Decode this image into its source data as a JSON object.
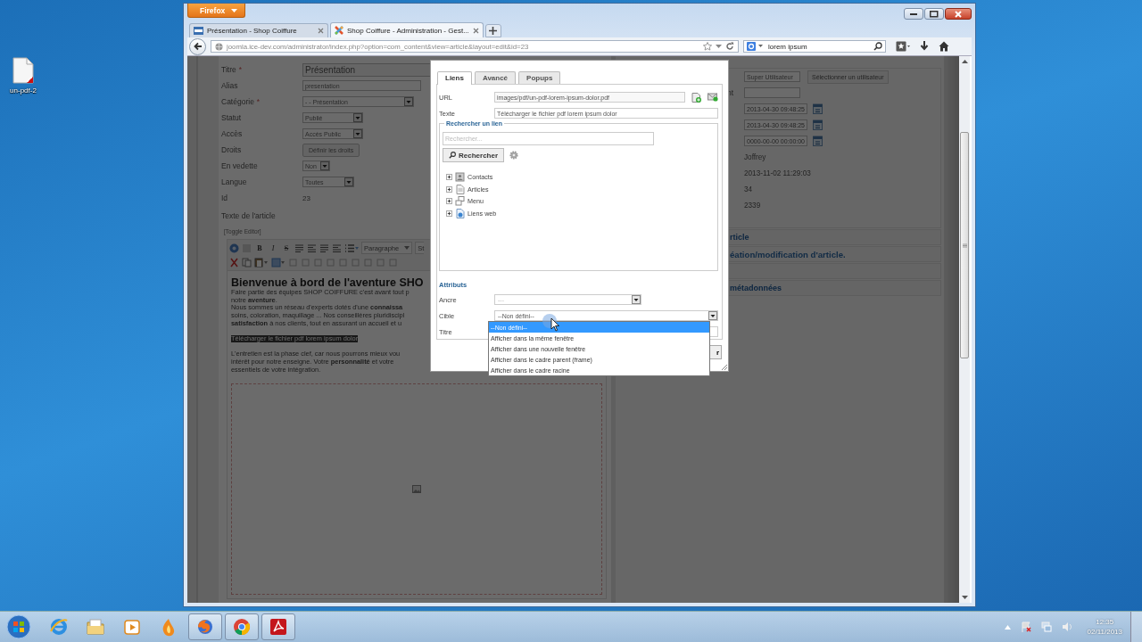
{
  "desktop_icons": [
    {
      "label": "un-pdf-2"
    }
  ],
  "browser": {
    "menu_button": "Firefox",
    "tabs": [
      {
        "kind": "site",
        "title": "Présentation - Shop Coiffure",
        "selected": false
      },
      {
        "kind": "admin",
        "title": "Shop Coiffure - Administration - Gest...",
        "selected": true
      }
    ],
    "address": "joomla.ice-dev.com/administrator/index.php?option=com_content&view=article&layout=edit&id=23",
    "search_value": "lorem ipsum"
  },
  "article_form": {
    "fields": [
      {
        "label": "Titre",
        "marker": "*",
        "kind": "title",
        "value": "Présentation"
      },
      {
        "label": "Alias",
        "kind": "text",
        "value": "presentation"
      },
      {
        "label": "Catégorie",
        "marker": "*",
        "kind": "select",
        "value": "- - Présentation"
      },
      {
        "label": "Statut",
        "kind": "select",
        "value": "Publié"
      },
      {
        "label": "Accès",
        "kind": "select",
        "value": "Accès Public"
      },
      {
        "label": "Droits",
        "kind": "button",
        "value": "Définir les droits"
      },
      {
        "label": "En vedette",
        "kind": "select",
        "value": "Non"
      },
      {
        "label": "Langue",
        "kind": "select",
        "value": "Toutes"
      },
      {
        "label": "Id",
        "kind": "static",
        "value": "23"
      }
    ],
    "text_label": "Texte de l'article",
    "toggle_editor": "[Toggle Editor]",
    "format_buttons": [
      "B",
      "I",
      "S"
    ],
    "format_select": "Paragraphe",
    "styles_select": "St"
  },
  "editor": {
    "heading": "Bienvenue à bord de l'aventure SHO",
    "blocks": [
      {
        "kind": "paragraph",
        "lines": [
          "Faire partie des équipes SHOP COIFFURE c'est avant tout p",
          "notre **aventure**.",
          "Nous sommes un réseau d'experts dotés d'une **connaissa**",
          "soins, coloration, maquillage ... Nos conseillères pluridiscipl",
          "**satisfaction** à nos clients, tout en assurant un accueil et u"
        ]
      },
      {
        "kind": "link",
        "lines": [
          "Télécharger le fichier pdf lorem ipsum dolor"
        ]
      },
      {
        "kind": "paragraph",
        "lines": [
          "L'entretien est la phase clef, car nous pourrons mieux vou",
          "intérêt pour notre enseigne. Votre **personnalité** et votre",
          "essentiels de votre intégration."
        ]
      }
    ]
  },
  "publishing_panel": {
    "rows": [
      {
        "kind": "user",
        "value": "Super Utilisateur",
        "button": "Sélectionner un utilisateur"
      },
      {
        "kind": "field",
        "label": "nt"
      },
      {
        "kind": "date",
        "value": "2013-04-30 09:48:25"
      },
      {
        "kind": "date",
        "value": "2013-04-30 09:48:25"
      },
      {
        "kind": "date",
        "value": "0000-00-00 00:00:00"
      },
      {
        "kind": "static",
        "value": "Joffrey"
      },
      {
        "kind": "static",
        "value": "2013-11-02 11:29:03"
      },
      {
        "kind": "static",
        "value": "34"
      },
      {
        "kind": "static",
        "value": "2339"
      }
    ],
    "sections": [
      {
        "kind": "heading",
        "title": "rticle"
      },
      {
        "kind": "note",
        "title": "éation/modification d'article."
      },
      {
        "kind": "blank"
      },
      {
        "kind": "heading",
        "title": "métadonnées"
      }
    ]
  },
  "link_dialog": {
    "tabs": [
      {
        "label": "Liens",
        "selected": true
      },
      {
        "label": "Avancé",
        "selected": false
      },
      {
        "label": "Popups",
        "selected": false
      }
    ],
    "url_label": "URL",
    "url": "images/pdf/un-pdf-lorem-ipsum-dolor.pdf",
    "text_label": "Texte",
    "text": "Télécharger le fichier pdf lorem ipsum dolor",
    "search_legend": "Rechercher un lien",
    "search_placeholder": "Rechercher...",
    "search_button": "Rechercher",
    "tree": [
      {
        "kind": "contacts",
        "label": "Contacts",
        "expanded": false
      },
      {
        "kind": "articles",
        "label": "Articles",
        "expanded": false
      },
      {
        "kind": "menu",
        "label": "Menu",
        "expanded": false
      },
      {
        "kind": "weblinks",
        "label": "Liens web",
        "expanded": false
      }
    ],
    "attributes_heading": "Attributs",
    "anchor_label": "Ancre",
    "anchor_value": "---",
    "target_label": "Cible",
    "target_value": "--Non défini--",
    "title_label": "Titre",
    "target_options": [
      {
        "label": "--Non défini--",
        "selected": true
      },
      {
        "label": "Afficher dans la même fenêtre",
        "selected": false
      },
      {
        "label": "Afficher dans une nouvelle fenêtre",
        "selected": false
      },
      {
        "label": "Afficher dans le cadre parent (frame)",
        "selected": false
      },
      {
        "label": "Afficher dans le cadre racine",
        "selected": false
      }
    ],
    "insert_button": "r"
  },
  "taskbar": {
    "apps": [
      {
        "kind": "ie",
        "running": false
      },
      {
        "kind": "explorer",
        "running": false
      },
      {
        "kind": "media",
        "running": false
      },
      {
        "kind": "flame",
        "running": false
      },
      {
        "kind": "firefox",
        "running": true
      },
      {
        "kind": "chrome",
        "running": true
      },
      {
        "kind": "acrobat",
        "running": true
      }
    ],
    "time": "12:35",
    "date": "02/11/2013"
  }
}
